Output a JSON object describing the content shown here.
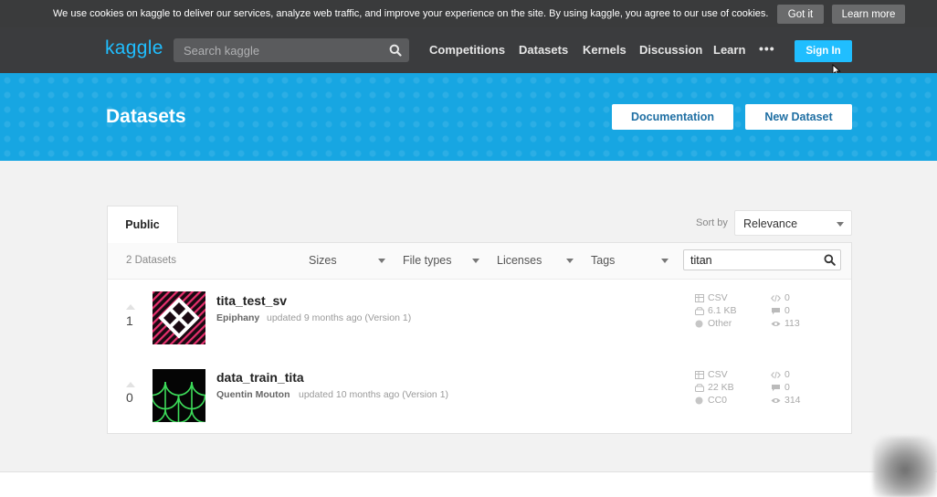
{
  "cookie_bar": {
    "text": "We use cookies on kaggle to deliver our services, analyze web traffic, and improve your experience on the site. By using kaggle, you agree to our use of cookies.",
    "got_it_label": "Got it",
    "learn_more_label": "Learn more"
  },
  "nav": {
    "logo": "kaggle",
    "search_placeholder": "Search kaggle",
    "links": [
      "Competitions",
      "Datasets",
      "Kernels",
      "Discussion",
      "Learn"
    ],
    "more": "•••",
    "sign_in_label": "Sign In"
  },
  "hero": {
    "title": "Datasets",
    "documentation_label": "Documentation",
    "new_dataset_label": "New Dataset"
  },
  "tabs": {
    "public_label": "Public"
  },
  "sort": {
    "label": "Sort by",
    "value": "Relevance"
  },
  "filters": {
    "count": "2 Datasets",
    "sizes": "Sizes",
    "file_types": "File types",
    "licenses": "Licenses",
    "tags": "Tags",
    "search_value": "titan"
  },
  "datasets": [
    {
      "votes": "1",
      "title": "tita_test_sv",
      "owner": "Epiphany",
      "updated": "updated 9 months ago (Version 1)",
      "file_type": "CSV",
      "size": "6.1 KB",
      "license": "Other",
      "kernels": "0",
      "comments": "0",
      "views": "113"
    },
    {
      "votes": "0",
      "title": "data_train_tita",
      "owner": "Quentin Mouton",
      "updated": "updated 10 months ago (Version 1)",
      "file_type": "CSV",
      "size": "22 KB",
      "license": "CC0",
      "kernels": "0",
      "comments": "0",
      "views": "314"
    }
  ],
  "colors": {
    "brand_blue": "#20beff",
    "hero_blue": "#17a6e2",
    "nav_bg": "#3b3c3e",
    "cookie_bg": "#3a3b3c",
    "thumb1_pink": "#e8306e",
    "thumb2_green": "#3ddc5a"
  }
}
